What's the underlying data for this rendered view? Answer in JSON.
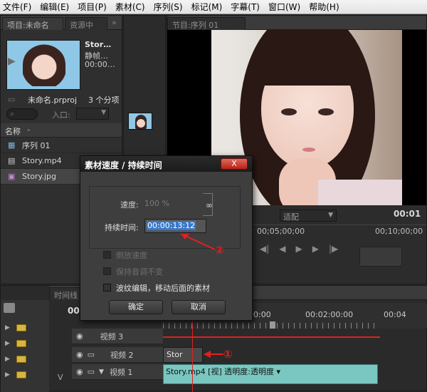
{
  "menu": [
    "文件(F)",
    "编辑(E)",
    "项目(P)",
    "素材(C)",
    "序列(S)",
    "标记(M)",
    "字幕(T)",
    "窗口(W)",
    "帮助(H)"
  ],
  "project": {
    "tabs": [
      "项目:未命名",
      "资源中"
    ],
    "clip_name": "Stor…",
    "clip_type": "静帧…",
    "clip_duration": "00:00…",
    "project_file": "未命名.prproj",
    "item_count": "3 个分项",
    "entry_label": "入口:",
    "column_name": "名称",
    "items": [
      "序列 01",
      "Story.mp4",
      "Story.jpg"
    ]
  },
  "program": {
    "tab": "节目:序列 01",
    "fit_value": "适配",
    "timecode_right": "00:01",
    "ruler": [
      "00;05;00;00",
      "00;10;00;00"
    ]
  },
  "dialog": {
    "title": "素材速度 / 持续时间",
    "close": "X",
    "speed_label": "速度:",
    "speed_value": "100 %",
    "duration_label": "持续时间:",
    "duration_value": "00:00:13:12",
    "reverse": "倒放速度",
    "keep_pitch": "保持音调不变",
    "ripple": "波纹编辑，移动后面的素材",
    "ok": "确定",
    "cancel": "取消"
  },
  "timeline": {
    "tab": "时间线",
    "current": "00",
    "ruler": [
      "00:00",
      "00:02:00:00",
      "00:04"
    ],
    "tracks": [
      {
        "name": "视频 3"
      },
      {
        "name": "视频 2",
        "clip": "Stor"
      },
      {
        "name": "视频 1",
        "clip": "Story.mp4 [视] 透明度:透明度 ▾"
      }
    ],
    "v_label": "V"
  },
  "annotations": [
    "①",
    "②"
  ],
  "colors": {
    "annotation_red": "#e02020",
    "selection_blue": "#3a78c8",
    "clip_teal": "#79c7c0"
  }
}
